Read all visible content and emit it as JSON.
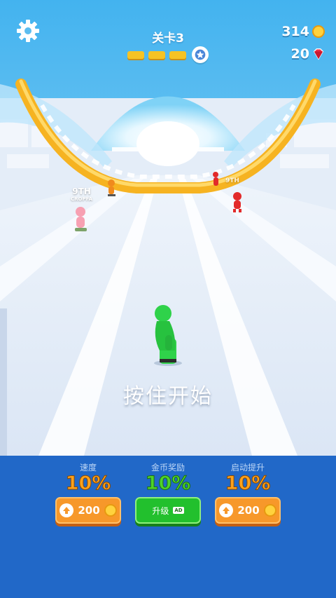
{
  "hud": {
    "level_label": "关卡3",
    "level_progress_segments": 3,
    "coins": "314",
    "gems": "20"
  },
  "prompt": {
    "hold_text": "按住开始"
  },
  "racers": [
    {
      "name_tag": "9TH",
      "sub": "CROPFA"
    },
    {
      "name_tag": "9TH",
      "sub": ""
    }
  ],
  "upgrades": [
    {
      "title": "速度",
      "percent": "10%",
      "cost": "200",
      "style": "orange"
    },
    {
      "title": "金币奖励",
      "percent": "10%",
      "button_label": "升级",
      "ad_label": "AD",
      "style": "green"
    },
    {
      "title": "启动提升",
      "percent": "10%",
      "cost": "200",
      "style": "orange"
    }
  ],
  "colors": {
    "panel": "#2168c8",
    "sky_top": "#43b3ef",
    "track": "#f6b321",
    "player": "#2fd24a"
  }
}
